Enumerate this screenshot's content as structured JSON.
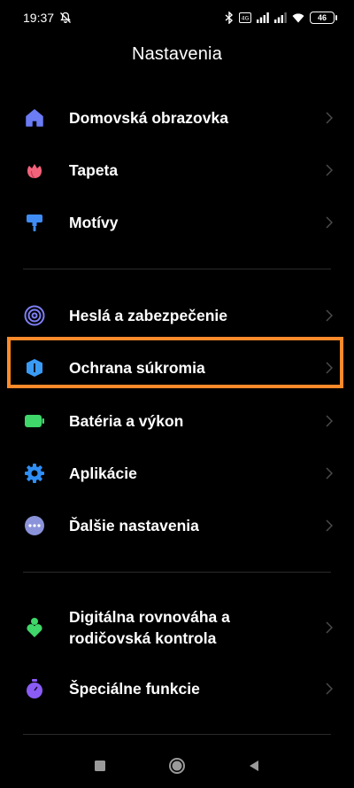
{
  "status_bar": {
    "time": "19:37",
    "battery_level": "46",
    "icons": [
      "mute-icon",
      "bluetooth-icon",
      "volte-icon",
      "signal-icon",
      "signal-icon",
      "wifi-icon",
      "battery-icon"
    ]
  },
  "title": "Nastavenia",
  "groups": [
    {
      "items": [
        {
          "label": "Domovská obrazovka",
          "icon": "home-icon",
          "color": "#6b7cf5"
        },
        {
          "label": "Tapeta",
          "icon": "flower-icon",
          "color": "#f2627a"
        },
        {
          "label": "Motívy",
          "icon": "paint-roller-icon",
          "color": "#3f8cf5"
        }
      ]
    },
    {
      "items": [
        {
          "label": "Heslá a zabezpečenie",
          "icon": "fingerprint-icon",
          "color": "#7d7ff5"
        },
        {
          "label": "Ochrana súkromia",
          "icon": "shield-icon",
          "color": "#3a9bf5",
          "highlighted": true
        },
        {
          "label": "Batéria a výkon",
          "icon": "battery-icon",
          "color": "#3fd66a"
        },
        {
          "label": "Aplikácie",
          "icon": "gear-icon",
          "color": "#2f8ef5"
        },
        {
          "label": "Ďalšie nastavenia",
          "icon": "more-icon",
          "color": "#8a93d9"
        }
      ]
    },
    {
      "items": [
        {
          "label": "Digitálna rovnováha a\nrodičovská kontrola",
          "icon": "wellbeing-icon",
          "color": "#3fd66a"
        },
        {
          "label": "Špeciálne funkcie",
          "icon": "stopwatch-icon",
          "color": "#8a5cf5"
        }
      ]
    }
  ],
  "highlight_color": "#ff8a2b",
  "nav_bar": [
    "recents-button",
    "home-button",
    "back-button"
  ]
}
